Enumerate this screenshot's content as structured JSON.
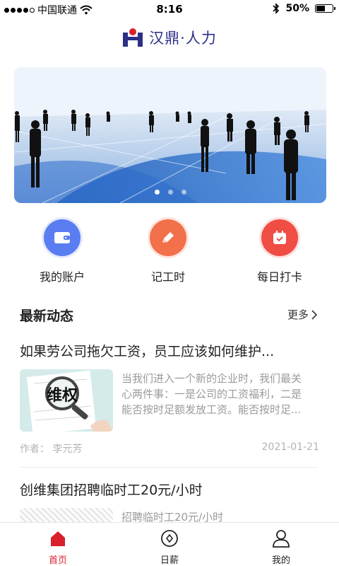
{
  "status_bar": {
    "carrier": "中国联通",
    "time": "8:16",
    "battery": "50%",
    "battery_level": 0.5
  },
  "header": {
    "logo_text": "汉鼎·人力"
  },
  "banner": {
    "slide_count": 3,
    "active_index": 0
  },
  "quick_actions": [
    {
      "label": "我的账户",
      "icon": "wallet-icon",
      "color": "#5b7df2"
    },
    {
      "label": "记工时",
      "icon": "pencil-icon",
      "color": "#f2704a"
    },
    {
      "label": "每日打卡",
      "icon": "calendar-check-icon",
      "color": "#f04d45"
    }
  ],
  "news_section": {
    "title": "最新动态",
    "more": "更多"
  },
  "news": [
    {
      "title": "如果劳公司拖欠工资，员工应该如何维护...",
      "summary_lines": [
        "当我们进入一个新的企业时，我们最关",
        "心两件事：一是公司的工资福利，二是",
        "能否按时足额发放工资。能否按时足..."
      ],
      "author": "作者：  李元芳",
      "date": "2021-01-21",
      "thumb_text": "维权"
    },
    {
      "title": "创维集团招聘临时工20元/小时",
      "summary_lines": [
        "招聘临时工20元/小时"
      ]
    }
  ],
  "tabbar": {
    "tabs": [
      {
        "label": "首页",
        "icon": "home-icon",
        "active": true
      },
      {
        "label": "日薪",
        "icon": "coin-icon",
        "active": false
      },
      {
        "label": "我的",
        "icon": "user-icon",
        "active": false
      }
    ],
    "accent_color": "#d8202c"
  }
}
